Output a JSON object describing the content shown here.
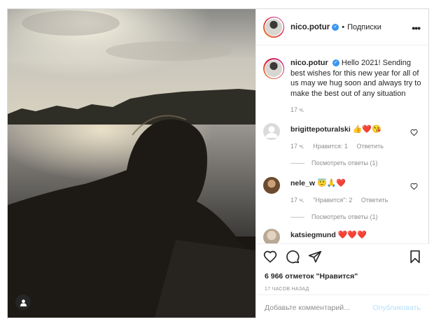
{
  "post": {
    "username": "nico.potur",
    "verified_mark": "✓",
    "dot": "•",
    "follow_label": "Подписки",
    "more_label": "•••",
    "caption_user": "nico.potur",
    "caption_text": "Hello 2021! Sending best wishes for this new year for all of us may we hug soon and always try to make the best out of any situation",
    "caption_time": "17 ч."
  },
  "comments": [
    {
      "user": "brigittepoturalski",
      "emoji": "👍❤️😘",
      "time": "17 ч.",
      "likes": "Нравится: 1",
      "reply": "Ответить",
      "view_replies": "Посмотреть ответы (1)"
    },
    {
      "user": "nele_w",
      "emoji": "😇🙏❤️",
      "time": "17 ч.",
      "likes": "\"Нравится\": 2",
      "reply": "Ответить",
      "view_replies": "Посмотреть ответы (1)"
    },
    {
      "user": "katsiegmund",
      "emoji": "❤️❤️❤️"
    }
  ],
  "footer": {
    "likes": "6 966 отметок \"Нравится\"",
    "time_ago": "17 ЧАСОВ НАЗАД",
    "comment_placeholder": "Добавьте комментарий...",
    "publish_label": "Опубликовать"
  },
  "icons": [
    "heart-icon",
    "comment-icon",
    "share-icon",
    "bookmark-icon",
    "user-tag-icon"
  ],
  "colors": {
    "verified": "#3897f0",
    "publish": "#b2dffc",
    "muted": "#8e8e8e"
  }
}
